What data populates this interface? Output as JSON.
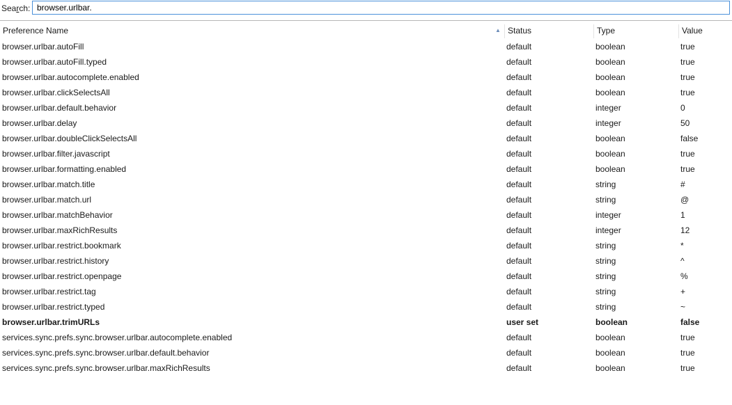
{
  "search": {
    "label": "Search:",
    "label_accesskey": "r",
    "value": "browser.urlbar."
  },
  "columns": [
    {
      "label": "Preference Name"
    },
    {
      "label": "Status"
    },
    {
      "label": "Type"
    },
    {
      "label": "Value"
    }
  ],
  "sort_indicator": "▲",
  "rows": [
    {
      "name": "browser.urlbar.autoFill",
      "status": "default",
      "type": "boolean",
      "value": "true",
      "modified": false
    },
    {
      "name": "browser.urlbar.autoFill.typed",
      "status": "default",
      "type": "boolean",
      "value": "true",
      "modified": false
    },
    {
      "name": "browser.urlbar.autocomplete.enabled",
      "status": "default",
      "type": "boolean",
      "value": "true",
      "modified": false
    },
    {
      "name": "browser.urlbar.clickSelectsAll",
      "status": "default",
      "type": "boolean",
      "value": "true",
      "modified": false
    },
    {
      "name": "browser.urlbar.default.behavior",
      "status": "default",
      "type": "integer",
      "value": "0",
      "modified": false
    },
    {
      "name": "browser.urlbar.delay",
      "status": "default",
      "type": "integer",
      "value": "50",
      "modified": false
    },
    {
      "name": "browser.urlbar.doubleClickSelectsAll",
      "status": "default",
      "type": "boolean",
      "value": "false",
      "modified": false
    },
    {
      "name": "browser.urlbar.filter.javascript",
      "status": "default",
      "type": "boolean",
      "value": "true",
      "modified": false
    },
    {
      "name": "browser.urlbar.formatting.enabled",
      "status": "default",
      "type": "boolean",
      "value": "true",
      "modified": false
    },
    {
      "name": "browser.urlbar.match.title",
      "status": "default",
      "type": "string",
      "value": "#",
      "modified": false
    },
    {
      "name": "browser.urlbar.match.url",
      "status": "default",
      "type": "string",
      "value": "@",
      "modified": false
    },
    {
      "name": "browser.urlbar.matchBehavior",
      "status": "default",
      "type": "integer",
      "value": "1",
      "modified": false
    },
    {
      "name": "browser.urlbar.maxRichResults",
      "status": "default",
      "type": "integer",
      "value": "12",
      "modified": false
    },
    {
      "name": "browser.urlbar.restrict.bookmark",
      "status": "default",
      "type": "string",
      "value": "*",
      "modified": false
    },
    {
      "name": "browser.urlbar.restrict.history",
      "status": "default",
      "type": "string",
      "value": "^",
      "modified": false
    },
    {
      "name": "browser.urlbar.restrict.openpage",
      "status": "default",
      "type": "string",
      "value": "%",
      "modified": false
    },
    {
      "name": "browser.urlbar.restrict.tag",
      "status": "default",
      "type": "string",
      "value": "+",
      "modified": false
    },
    {
      "name": "browser.urlbar.restrict.typed",
      "status": "default",
      "type": "string",
      "value": "~",
      "modified": false
    },
    {
      "name": "browser.urlbar.trimURLs",
      "status": "user set",
      "type": "boolean",
      "value": "false",
      "modified": true
    },
    {
      "name": "services.sync.prefs.sync.browser.urlbar.autocomplete.enabled",
      "status": "default",
      "type": "boolean",
      "value": "true",
      "modified": false
    },
    {
      "name": "services.sync.prefs.sync.browser.urlbar.default.behavior",
      "status": "default",
      "type": "boolean",
      "value": "true",
      "modified": false
    },
    {
      "name": "services.sync.prefs.sync.browser.urlbar.maxRichResults",
      "status": "default",
      "type": "boolean",
      "value": "true",
      "modified": false
    }
  ]
}
